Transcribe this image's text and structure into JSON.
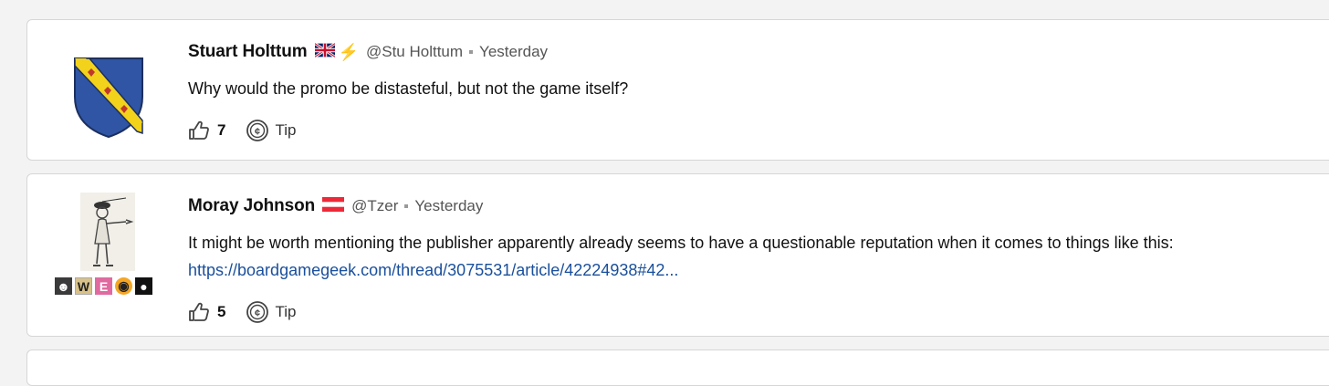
{
  "comments": [
    {
      "username": "Stuart Holttum",
      "handle": "@Stu Holttum",
      "time": "Yesterday",
      "text": "Why would the promo be distasteful, but not the game itself?",
      "likes": "7",
      "tip_label": "Tip",
      "flag": "united-kingdom-flag-icon",
      "extra_icon": "lightning-bolt-icon",
      "avatar": "coat-of-arms-shield-icon"
    },
    {
      "username": "Moray Johnson",
      "handle": "@Tzer",
      "time": "Yesterday",
      "text": "It might be worth mentioning the publisher apparently already seems to have a questionable reputation when it comes to things like this:",
      "link": "https://boardgamegeek.com/thread/3075531/article/42224938#42...",
      "likes": "5",
      "tip_label": "Tip",
      "flag": "austria-flag-icon",
      "avatar": "drawn-figure-with-pistol-icon",
      "badges": [
        "face-badge",
        "W",
        "E",
        "eye-badge",
        "penguin-badge"
      ]
    }
  ],
  "colors": {
    "link": "#1a4f9c",
    "shield_blue": "#2f55a4",
    "shield_band": "#f2d21b",
    "bolt": "#f0a500"
  }
}
